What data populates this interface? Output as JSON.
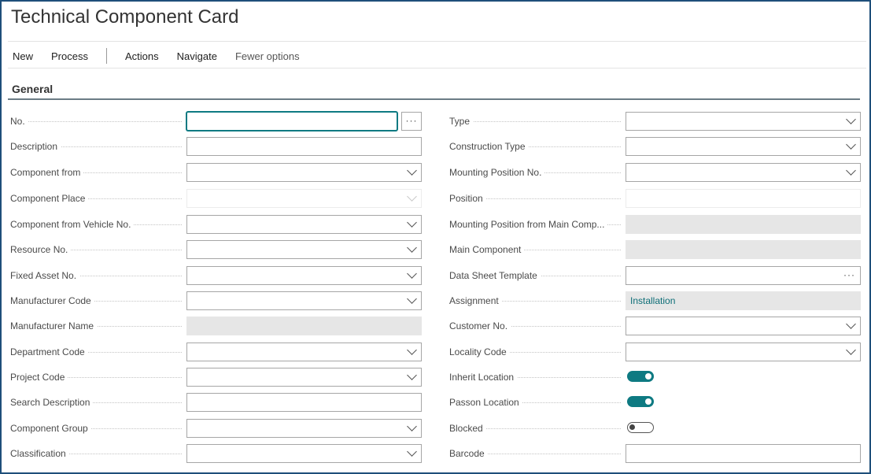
{
  "page": {
    "title": "Technical Component Card"
  },
  "actions": {
    "new": "New",
    "process": "Process",
    "actions": "Actions",
    "navigate": "Navigate",
    "fewer": "Fewer options"
  },
  "section": {
    "general": "General"
  },
  "left": {
    "no": "No.",
    "description": "Description",
    "component_from": "Component from",
    "component_place": "Component Place",
    "component_vehicle": "Component from Vehicle No.",
    "resource_no": "Resource No.",
    "fixed_asset": "Fixed Asset No.",
    "manufacturer_code": "Manufacturer Code",
    "manufacturer_name": "Manufacturer Name",
    "department_code": "Department Code",
    "project_code": "Project Code",
    "search_description": "Search Description",
    "component_group": "Component Group",
    "classification": "Classification"
  },
  "right": {
    "type": "Type",
    "construction_type": "Construction Type",
    "mounting_position": "Mounting Position No.",
    "position": "Position",
    "mounting_main": "Mounting Position from Main Comp...",
    "main_component": "Main Component",
    "data_sheet": "Data Sheet Template",
    "assignment": "Assignment",
    "assignment_value": "Installation",
    "customer_no": "Customer No.",
    "locality_code": "Locality Code",
    "inherit_location": "Inherit Location",
    "passon_location": "Passon Location",
    "blocked": "Blocked",
    "barcode": "Barcode"
  },
  "toggles": {
    "inherit_location": true,
    "passon_location": true,
    "blocked": false
  },
  "colors": {
    "accent": "#0e7a82",
    "frame": "#1e4f7a"
  }
}
